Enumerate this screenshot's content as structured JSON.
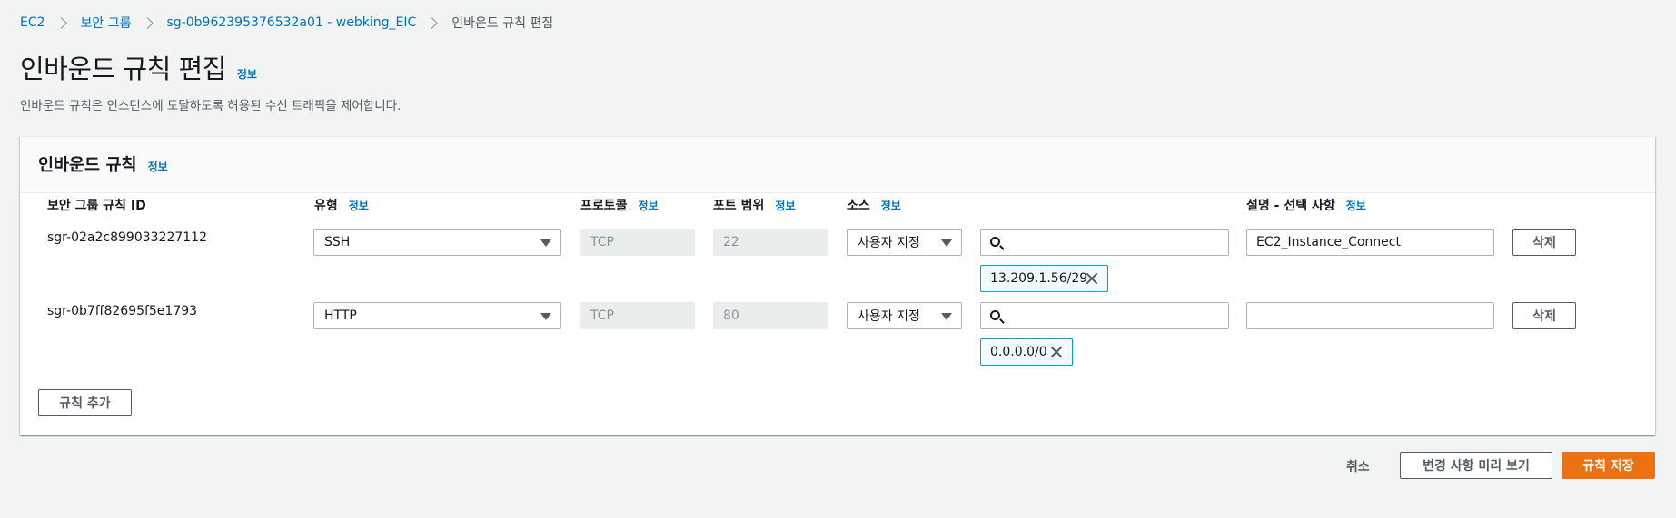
{
  "breadcrumb": {
    "items": [
      "EC2",
      "보안 그룹",
      "sg-0b962395376532a01 - webking_EIC",
      "인바운드 규칙 편집"
    ]
  },
  "page": {
    "title": "인바운드 규칙 편집",
    "info": "정보",
    "description": "인바운드 규칙은 인스턴스에 도달하도록 허용된 수신 트래픽을 제어합니다."
  },
  "container": {
    "title": "인바운드 규칙",
    "info": "정보"
  },
  "columns": {
    "rule_id": "보안 그룹 규칙 ID",
    "type": "유형",
    "protocol": "프로토콜",
    "port_range": "포트 범위",
    "source": "소스",
    "description": "설명 - 선택 사항",
    "info": "정보"
  },
  "rules": [
    {
      "id": "sgr-02a2c899033227112",
      "type": "SSH",
      "protocol": "TCP",
      "port": "22",
      "source_type": "사용자 지정",
      "search_value": "",
      "cidr": "13.209.1.56/29",
      "description": "EC2_Instance_Connect",
      "delete": "삭제"
    },
    {
      "id": "sgr-0b7ff82695f5e1793",
      "type": "HTTP",
      "protocol": "TCP",
      "port": "80",
      "source_type": "사용자 지정",
      "search_value": "",
      "cidr": "0.0.0.0/0",
      "description": "",
      "delete": "삭제"
    }
  ],
  "add_rule": "규칙 추가",
  "footer": {
    "cancel": "취소",
    "preview": "변경 사항 미리 보기",
    "save": "규칙 저장"
  },
  "colors": {
    "link": "#0073bb",
    "primary": "#ec7211",
    "token_border": "#00a1c9"
  }
}
